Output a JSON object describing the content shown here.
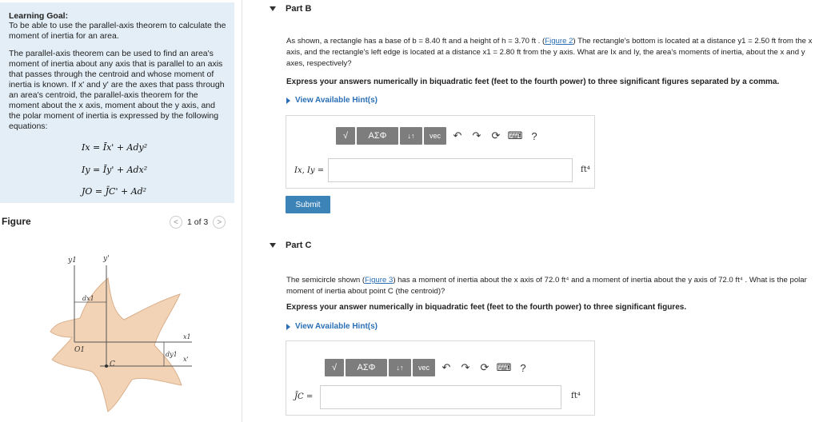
{
  "left": {
    "goal_title": "Learning Goal:",
    "goal_text": "To be able to use the parallel-axis theorem to calculate the moment of inertia for an area.",
    "goal_p2": "The parallel-axis theorem can be used to find an area's moment of inertia about any axis that is parallel to an axis that passes through the centroid and whose moment of inertia is known. If x' and y' are the axes that pass through an area's centroid, the parallel-axis theorem for the moment about the x axis, moment about the y axis, and the polar moment of inertia is expressed by the following equations:",
    "eq1": "Ix = Īx' + Ady²",
    "eq2": "Iy = Īy' + Adx²",
    "eq3": "JO = J̄C' + Ad²",
    "figure_label": "Figure",
    "pager_text": "1 of 3",
    "fig_labels": {
      "y1": "y1",
      "yprime": "y'",
      "dx1": "dx1",
      "dy1": "dy1",
      "x1": "x1",
      "xprime": "x'",
      "O1": "O1",
      "C": "C"
    }
  },
  "partB": {
    "title": "Part B",
    "text1": "As shown, a rectangle has a base of b = 8.40 ft and a height of h = 3.70 ft . (",
    "fig_link": "Figure 2",
    "text2": ") The rectangle's bottom is located at a distance y1 = 2.50 ft from the x axis, and the rectangle's left edge is located at a distance x1 = 2.80 ft from the y axis. What are Ix and Iy, the area's moments of inertia, about the x and y axes, respectively?",
    "instruction": "Express your answers numerically in biquadratic feet (feet to the fourth power) to three significant figures separated by a comma.",
    "hint": "View Available Hint(s)",
    "label": "Ix, Iy =",
    "unit": "ft⁴",
    "submit": "Submit",
    "input_value": ""
  },
  "partC": {
    "title": "Part C",
    "text1": "The semicircle shown (",
    "fig_link": "Figure 3",
    "text2": ") has a moment of inertia about the x axis of 72.0 ft⁴ and a moment of inertia about the y axis of 72.0 ft⁴ . What is the polar moment of inertia about point C (the centroid)?",
    "instruction": "Express your answer numerically in biquadratic feet (feet to the fourth power) to three significant figures.",
    "hint": "View Available Hint(s)",
    "label": "J̄C =",
    "unit": "ft⁴",
    "input_value": ""
  },
  "toolbar": {
    "sqrt": "√",
    "greek": "ΑΣΦ",
    "arrows": "↓↑",
    "vec": "vec",
    "undo": "↶",
    "redo": "↷",
    "reset": "⟳",
    "keyboard": "⌨",
    "help": "?"
  },
  "colors": {
    "goal_bg": "#e3eef6",
    "link": "#2a6fb5",
    "submit": "#3c83b8",
    "figure_fill": "#f3d3b5"
  }
}
